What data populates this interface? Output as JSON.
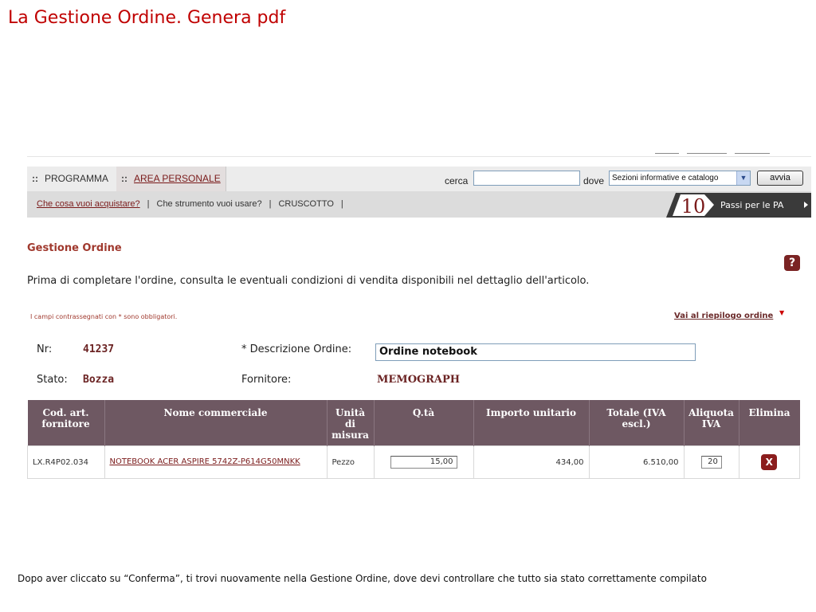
{
  "slide_title": "La Gestione Ordine. Genera pdf",
  "nav": {
    "tabs": [
      {
        "label": "PROGRAMMA"
      },
      {
        "label": "AREA PERSONALE"
      }
    ],
    "search_label": "cerca",
    "search_value": "",
    "where_label": "dove",
    "where_selected": "Sezioni informative e catalogo",
    "go_label": "avvia"
  },
  "subnav": {
    "items": [
      "Che cosa vuoi acquistare?",
      "Che strumento vuoi usare?",
      "CRUSCOTTO"
    ],
    "banner_number": "10",
    "banner_text": "Passi per le PA"
  },
  "main": {
    "section_title": "Gestione Ordine",
    "help_icon": "?",
    "intro": "Prima di completare l'ordine, consulta le eventuali condizioni di vendita disponibili nel dettaglio dell'articolo.",
    "required_note": "I campi contrassegnati con * sono obbligatori.",
    "summary_link": "Vai al riepilogo ordine",
    "nr_label": "Nr:",
    "nr_value": "41237",
    "desc_label": "* Descrizione Ordine:",
    "desc_value": "Ordine notebook",
    "stato_label": "Stato:",
    "stato_value": "Bozza",
    "fornitore_label": "Fornitore:",
    "fornitore_value": "MEMOGRAPH"
  },
  "table": {
    "headers": [
      "Cod. art. fornitore",
      "Nome commerciale",
      "Unità di misura",
      "Q.tà",
      "Importo unitario",
      "Totale (IVA escl.)",
      "Aliquota IVA",
      "Elimina"
    ],
    "rows": [
      {
        "code": "LX.R4P02.034",
        "name": "NOTEBOOK ACER ASPIRE 5742Z-P614G50MNKK",
        "unit": "Pezzo",
        "qty": "15,00",
        "unit_price": "434,00",
        "total": "6.510,00",
        "vat": "20",
        "delete_icon": "X"
      }
    ]
  },
  "caption": "Dopo aver cliccato su “Conferma”, ti trovi nuovamente nella Gestione Ordine, dove devi controllare che tutto sia stato correttamente compilato",
  "colors": {
    "title_red": "#c00000",
    "header_bg": "#6e5862",
    "accent_dark_red": "#6b2323"
  }
}
